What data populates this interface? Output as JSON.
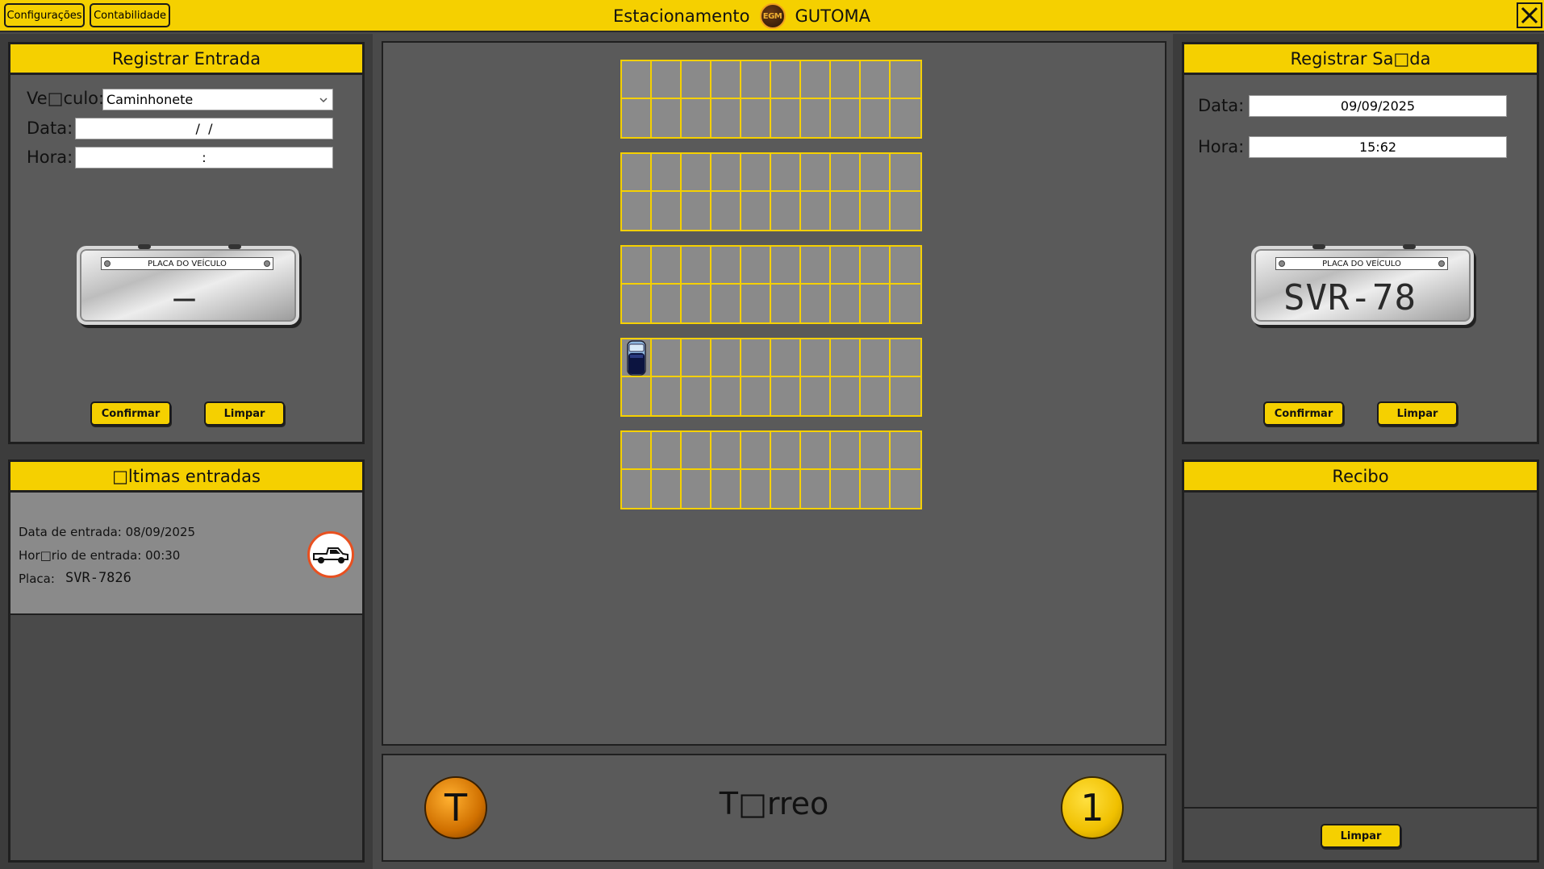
{
  "topbar": {
    "config_label": "Configurações",
    "accounting_label": "Contabilidade",
    "title_left": "Estacionamento",
    "logo_text": "EGM",
    "title_right": "GUTOMA"
  },
  "entry": {
    "title": "Registrar Entrada",
    "vehicle_label": "Ve□culo:",
    "vehicle_value": "Caminhonete",
    "date_label": "Data:",
    "date_value": "/  /",
    "time_label": "Hora:",
    "time_value": ":",
    "plate_band": "PLACA DO VEÍCULO",
    "plate_value": "–",
    "confirm_label": "Confirmar",
    "clear_label": "Limpar"
  },
  "recent": {
    "title": "□ltimas entradas",
    "date_text": "Data de entrada: 08/09/2025",
    "time_text": "Hor□rio de entrada: 00:30",
    "plate_label": "Placa:",
    "plate_value": "SVR-7826",
    "vehicle_icon": "pickup-truck-icon"
  },
  "lot": {
    "rows": 5,
    "spots_per_row": 20,
    "occupied_spot": {
      "row": 4,
      "spot": 1
    },
    "grid_color": "#f5d000",
    "spot_color": "#8a8a8a"
  },
  "floor": {
    "ground_button": "T",
    "label": "T□rreo",
    "first_button": "1"
  },
  "exit": {
    "title": "Registrar Sa□da",
    "date_label": "Data:",
    "date_value": "09/09/2025",
    "time_label": "Hora:",
    "time_value": "15:62",
    "plate_band": "PLACA DO VEÍCULO",
    "plate_value": "SVR-78",
    "confirm_label": "Confirmar",
    "clear_label": "Limpar"
  },
  "receipt": {
    "title": "Recibo",
    "clear_label": "Limpar"
  },
  "colors": {
    "accent": "#f5d000",
    "panel": "#5a5a5a",
    "border": "#1f1f1f"
  }
}
